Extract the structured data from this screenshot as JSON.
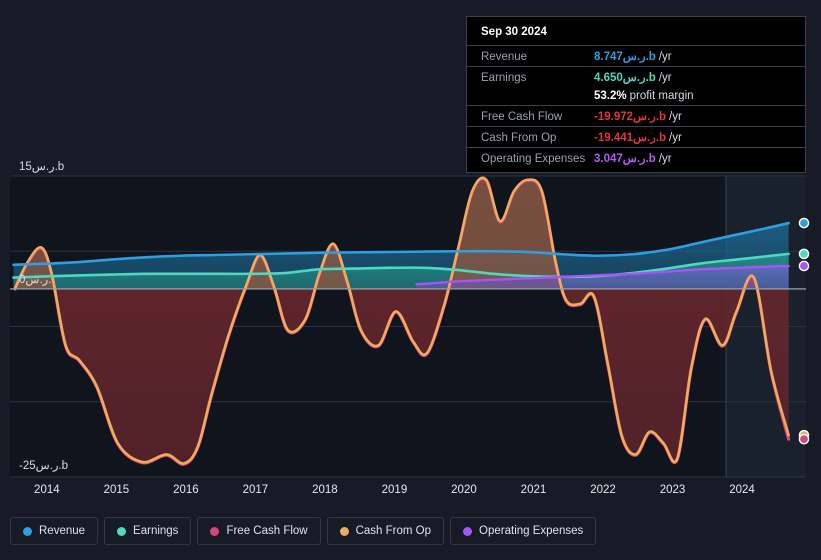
{
  "tooltip": {
    "date": "Sep 30 2024",
    "rows": [
      {
        "label": "Revenue",
        "value": "8.747ر.س.b",
        "unit": "/yr",
        "color": "#2e9fe0"
      },
      {
        "label": "Earnings",
        "value": "4.650ر.س.b",
        "unit": "/yr",
        "color": "#4fd8c0"
      },
      {
        "label": "",
        "value": "53.2%",
        "unit": "profit margin",
        "color": "#ffffff"
      },
      {
        "label": "Free Cash Flow",
        "value": "-19.972ر.س.b",
        "unit": "/yr",
        "color": "#e0383c"
      },
      {
        "label": "Cash From Op",
        "value": "-19.441ر.س.b",
        "unit": "/yr",
        "color": "#e0383c"
      },
      {
        "label": "Operating Expenses",
        "value": "3.047ر.س.b",
        "unit": "/yr",
        "color": "#b55cf5"
      }
    ]
  },
  "axis": {
    "y_top": "15ر.س.b",
    "y_zero": "0ر.س.",
    "y_bottom": "-25ر.س.b",
    "x_ticks": [
      "2014",
      "2015",
      "2016",
      "2017",
      "2018",
      "2019",
      "2020",
      "2021",
      "2022",
      "2023",
      "2024"
    ]
  },
  "legend": {
    "items": [
      {
        "label": "Revenue",
        "color": "#2e9fe0"
      },
      {
        "label": "Earnings",
        "color": "#4fd8c0"
      },
      {
        "label": "Free Cash Flow",
        "color": "#d9437e"
      },
      {
        "label": "Cash From Op",
        "color": "#eead5a"
      },
      {
        "label": "Operating Expenses",
        "color": "#a855f7"
      }
    ]
  },
  "chart_data": {
    "type": "area",
    "title": "",
    "xlabel": "",
    "ylabel": "ر.س.b",
    "ylim": [
      -25,
      15
    ],
    "grid": true,
    "legend_position": "bottom",
    "currency_suffix": "ر.س.b",
    "forecast_divider_year": 2023.85,
    "x_range": [
      2013.55,
      2025.0
    ],
    "series": [
      {
        "name": "Revenue",
        "color": "#2e9fe0",
        "fill": "#10455f",
        "x": [
          2013.6,
          2013.9,
          2014.2,
          2014.6,
          2015.0,
          2015.5,
          2016.0,
          2016.5,
          2017.0,
          2017.5,
          2018.0,
          2018.5,
          2019.0,
          2019.5,
          2020.0,
          2020.5,
          2021.0,
          2021.5,
          2022.0,
          2022.5,
          2023.0,
          2023.5,
          2024.0,
          2024.4,
          2024.75
        ],
        "y": [
          3.2,
          3.3,
          3.4,
          3.6,
          3.9,
          4.2,
          4.4,
          4.5,
          4.6,
          4.7,
          4.8,
          4.85,
          4.9,
          4.95,
          5.0,
          5.0,
          4.9,
          4.6,
          4.4,
          4.6,
          5.2,
          6.2,
          7.2,
          8.0,
          8.747
        ]
      },
      {
        "name": "Earnings",
        "color": "#4fd8c0",
        "fill": "#1a6f6b",
        "x": [
          2013.6,
          2013.9,
          2014.2,
          2014.6,
          2015.0,
          2015.5,
          2016.0,
          2016.5,
          2017.0,
          2017.5,
          2018.0,
          2018.5,
          2019.0,
          2019.5,
          2020.0,
          2020.5,
          2021.0,
          2021.5,
          2022.0,
          2022.5,
          2023.0,
          2023.5,
          2024.0,
          2024.4,
          2024.75
        ],
        "y": [
          1.5,
          1.6,
          1.7,
          1.8,
          1.9,
          2.0,
          2.0,
          2.0,
          2.0,
          2.1,
          2.6,
          2.7,
          2.8,
          2.8,
          2.5,
          2.0,
          1.7,
          1.6,
          1.7,
          2.1,
          2.7,
          3.4,
          3.9,
          4.3,
          4.65
        ]
      },
      {
        "name": "Operating Expenses",
        "color": "#a855f7",
        "fill": "#4a3f8c",
        "x": [
          2019.4,
          2019.7,
          2020.0,
          2020.5,
          2021.0,
          2021.5,
          2022.0,
          2022.5,
          2023.0,
          2023.5,
          2024.0,
          2024.4,
          2024.75
        ],
        "y": [
          0.6,
          0.8,
          1.0,
          1.2,
          1.4,
          1.6,
          1.8,
          2.0,
          2.3,
          2.6,
          2.8,
          2.95,
          3.047
        ]
      },
      {
        "name": "Cash From Op",
        "color": "#eead5a",
        "fill_pos": "#6e4a3a",
        "fill_neg": "#5e2327",
        "x": [
          2013.62,
          2013.8,
          2014.0,
          2014.15,
          2014.35,
          2014.55,
          2014.8,
          2015.1,
          2015.45,
          2015.8,
          2016.05,
          2016.25,
          2016.45,
          2016.7,
          2016.95,
          2017.15,
          2017.35,
          2017.55,
          2017.8,
          2018.0,
          2018.2,
          2018.4,
          2018.6,
          2018.85,
          2019.1,
          2019.35,
          2019.55,
          2019.8,
          2020.0,
          2020.2,
          2020.4,
          2020.6,
          2020.8,
          2021.0,
          2021.2,
          2021.4,
          2021.55,
          2021.75,
          2021.95,
          2022.15,
          2022.35,
          2022.55,
          2022.75,
          2022.95,
          2023.15,
          2023.35,
          2023.55,
          2023.8,
          2024.0,
          2024.25,
          2024.5,
          2024.75
        ],
        "y": [
          0.0,
          3.5,
          5.5,
          2.0,
          -7.5,
          -9.5,
          -13.0,
          -20.5,
          -23.0,
          -22.0,
          -23.2,
          -21.0,
          -14.0,
          -6.0,
          0.5,
          4.5,
          0.2,
          -5.5,
          -4.0,
          2.0,
          6.0,
          1.0,
          -5.5,
          -7.5,
          -3.0,
          -7.0,
          -8.5,
          -2.0,
          5.5,
          13.0,
          14.5,
          9.0,
          13.0,
          14.5,
          13.0,
          3.5,
          -1.5,
          -2.0,
          -1.0,
          -10.0,
          -19.5,
          -22.0,
          -19.0,
          -20.5,
          -22.5,
          -10.5,
          -4.0,
          -7.5,
          -3.0,
          1.5,
          -11.0,
          -19.441
        ]
      },
      {
        "name": "Free Cash Flow",
        "color": "#d9437e",
        "x": [
          2013.62,
          2013.8,
          2014.0,
          2014.15,
          2014.35,
          2014.55,
          2014.8,
          2015.1,
          2015.45,
          2015.8,
          2016.05,
          2016.25,
          2016.45,
          2016.7,
          2016.95,
          2017.15,
          2017.35,
          2017.55,
          2017.8,
          2018.0,
          2018.2,
          2018.4,
          2018.6,
          2018.85,
          2019.1,
          2019.35,
          2019.55,
          2019.8,
          2020.0,
          2020.2,
          2020.4,
          2020.6,
          2020.8,
          2021.0,
          2021.2,
          2021.4,
          2021.55,
          2021.75,
          2021.95,
          2022.15,
          2022.35,
          2022.55,
          2022.75,
          2022.95,
          2023.15,
          2023.35,
          2023.55,
          2023.8,
          2024.0,
          2024.25,
          2024.5,
          2024.75
        ],
        "y": [
          0.0,
          3.4,
          5.4,
          1.9,
          -7.6,
          -9.6,
          -13.1,
          -20.6,
          -23.1,
          -22.1,
          -23.3,
          -21.1,
          -14.1,
          -6.1,
          0.4,
          4.4,
          0.1,
          -5.6,
          -4.1,
          1.9,
          5.9,
          0.9,
          -5.6,
          -7.6,
          -3.1,
          -7.1,
          -8.6,
          -2.1,
          5.4,
          12.9,
          14.4,
          8.9,
          12.9,
          14.4,
          12.9,
          3.4,
          -1.6,
          -2.1,
          -1.1,
          -10.1,
          -19.6,
          -22.1,
          -19.1,
          -20.6,
          -22.6,
          -10.6,
          -4.1,
          -7.6,
          -3.1,
          1.4,
          -11.1,
          -19.972
        ]
      }
    ],
    "end_markers": [
      {
        "name": "Revenue",
        "value": 8.747,
        "color": "#2e9fe0"
      },
      {
        "name": "Earnings",
        "value": 4.65,
        "color": "#4fd8c0"
      },
      {
        "name": "Operating Expenses",
        "value": 3.047,
        "color": "#a855f7"
      },
      {
        "name": "Cash From Op",
        "value": -19.441,
        "color": "#eead5a"
      },
      {
        "name": "Free Cash Flow",
        "value": -19.972,
        "color": "#d9437e"
      }
    ]
  }
}
